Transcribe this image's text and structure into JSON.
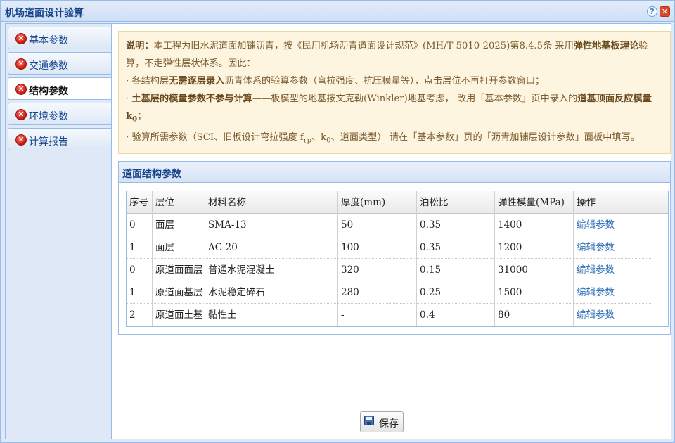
{
  "window": {
    "title": "机场道面设计验算",
    "help_icon": "?",
    "close_icon": "✕"
  },
  "sidebar": {
    "items": [
      {
        "label": "基本参数",
        "icon": "error-icon"
      },
      {
        "label": "交通参数",
        "icon": "error-icon"
      },
      {
        "label": "结构参数",
        "icon": "error-icon",
        "active": true
      },
      {
        "label": "环境参数",
        "icon": "error-icon"
      },
      {
        "label": "计算报告",
        "icon": "error-icon"
      }
    ],
    "icon_glyph": "✕"
  },
  "note": {
    "p1_lead": "说明：",
    "p1_a": "本工程为旧水泥道面加铺沥青，按《民用机场沥青道面设计规范》(MH/T 5010-2025)第8.4.5条 采用",
    "p1_bold": "弹性地基板理论",
    "p1_b": "验算，不走弹性层状体系。因此：",
    "p2_a": "· 各结构层",
    "p2_bold": "无需逐层录入",
    "p2_b": "沥青体系的验算参数（弯拉强度、抗压模量等），点击层位不再打开参数窗口；",
    "p3_a": "· ",
    "p3_bold": "土基层的模量参数不参与计算",
    "p3_b": "——板模型的地基按文克勒(Winkler)地基考虑， 改用「基本参数」页中录入的",
    "p3_bold2": "道基顶面反应模量 k",
    "p3_sub": "0",
    "p3_c": "；",
    "p4_a": "· 验算所需参数（SCI、旧板设计弯拉强度 f",
    "p4_sub1": "rp",
    "p4_b": "、k",
    "p4_sub2": "0",
    "p4_c": "、道面类型） 请在「基本参数」页的「沥青加铺层设计参数」面板中填写。"
  },
  "panel": {
    "title": "道面结构参数"
  },
  "table": {
    "headers": [
      "序号",
      "层位",
      "材料名称",
      "厚度(mm)",
      "泊松比",
      "弹性模量(MPa)",
      "操作"
    ],
    "rows": [
      [
        "0",
        "面层",
        "SMA-13",
        "50",
        "0.35",
        "1400",
        "编辑参数"
      ],
      [
        "1",
        "面层",
        "AC-20",
        "100",
        "0.35",
        "1200",
        "编辑参数"
      ],
      [
        "0",
        "原道面面层",
        "普通水泥混凝土",
        "320",
        "0.15",
        "31000",
        "编辑参数"
      ],
      [
        "1",
        "原道面基层",
        "水泥稳定碎石",
        "280",
        "0.25",
        "1500",
        "编辑参数"
      ],
      [
        "2",
        "原道面土基",
        "黏性土",
        "-",
        "0.4",
        "80",
        "编辑参数"
      ]
    ]
  },
  "footer": {
    "save_label": "保存",
    "save_icon": "floppy-disk-icon"
  }
}
